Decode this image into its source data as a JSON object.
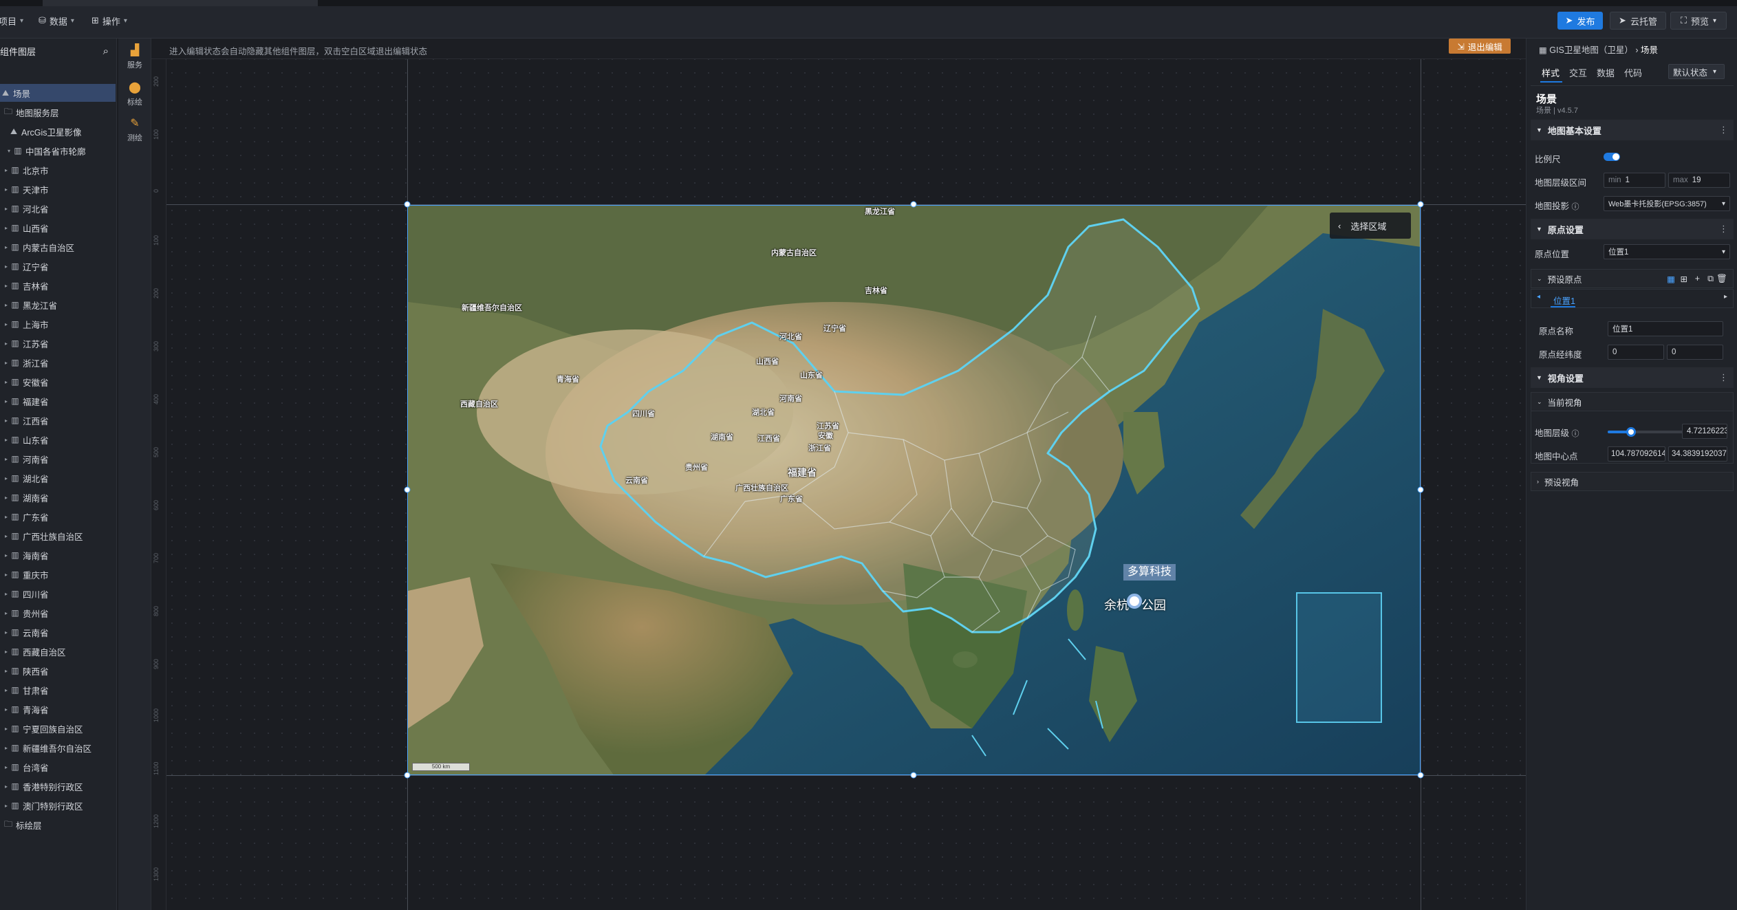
{
  "topbar": {
    "menus": [
      {
        "label": "项目",
        "icon": "folder-icon"
      },
      {
        "label": "数据",
        "icon": "database-icon"
      },
      {
        "label": "操作",
        "icon": "grid-icon"
      }
    ],
    "publish_label": "发布",
    "cloud_label": "云托管",
    "preview_label": "预览"
  },
  "layers": {
    "title": "组件图层",
    "items": [
      {
        "label": "场景",
        "icon": "scene-icon",
        "selected": true
      },
      {
        "label": "地图服务层",
        "icon": "folder-icon"
      },
      {
        "label": "ArcGis卫星影像",
        "icon": "scene-icon"
      },
      {
        "label": "中国各省市轮廓",
        "icon": "map-icon"
      },
      {
        "label": "北京市"
      },
      {
        "label": "天津市"
      },
      {
        "label": "河北省"
      },
      {
        "label": "山西省"
      },
      {
        "label": "内蒙古自治区"
      },
      {
        "label": "辽宁省"
      },
      {
        "label": "吉林省"
      },
      {
        "label": "黑龙江省"
      },
      {
        "label": "上海市"
      },
      {
        "label": "江苏省"
      },
      {
        "label": "浙江省"
      },
      {
        "label": "安徽省"
      },
      {
        "label": "福建省"
      },
      {
        "label": "江西省"
      },
      {
        "label": "山东省"
      },
      {
        "label": "河南省"
      },
      {
        "label": "湖北省"
      },
      {
        "label": "湖南省"
      },
      {
        "label": "广东省"
      },
      {
        "label": "广西壮族自治区"
      },
      {
        "label": "海南省"
      },
      {
        "label": "重庆市"
      },
      {
        "label": "四川省"
      },
      {
        "label": "贵州省"
      },
      {
        "label": "云南省"
      },
      {
        "label": "西藏自治区"
      },
      {
        "label": "陕西省"
      },
      {
        "label": "甘肃省"
      },
      {
        "label": "青海省"
      },
      {
        "label": "宁夏回族自治区"
      },
      {
        "label": "新疆维吾尔自治区"
      },
      {
        "label": "台湾省"
      },
      {
        "label": "香港特别行政区"
      },
      {
        "label": "澳门特别行政区"
      },
      {
        "label": "标绘层",
        "icon": "folder-icon"
      }
    ]
  },
  "tools": [
    {
      "label": "服务",
      "icon": "map-service-icon",
      "color": "#e8a23a"
    },
    {
      "label": "标绘",
      "icon": "pin-icon",
      "color": "#e8a23a"
    },
    {
      "label": "测绘",
      "icon": "measure-icon",
      "color": "#e8a23a"
    }
  ],
  "canvas": {
    "hint": "进入编辑状态会自动隐藏其他组件图层，双击空白区域退出编辑状态",
    "exit_label": "退出编辑",
    "ruler_ticks": [
      "200",
      "100",
      "0",
      "100",
      "200",
      "300",
      "400",
      "500",
      "600",
      "700",
      "800",
      "900",
      "1000",
      "1100",
      "1200",
      "1300"
    ]
  },
  "map": {
    "select_area_label": "选择区域",
    "scale_label": "500 km",
    "company_label": "多算科技",
    "poi_label": "余杭　公园",
    "provinces": [
      {
        "name": "黑龙江省"
      },
      {
        "name": "内蒙古自治区"
      },
      {
        "name": "吉林省"
      },
      {
        "name": "辽宁省"
      },
      {
        "name": "新疆维吾尔自治区"
      },
      {
        "name": "河北省"
      },
      {
        "name": "山西省"
      },
      {
        "name": "山东省"
      },
      {
        "name": "青海省"
      },
      {
        "name": "河南省"
      },
      {
        "name": "西藏自治区"
      },
      {
        "name": "江苏省"
      },
      {
        "name": "安徽"
      },
      {
        "name": "湖北省"
      },
      {
        "name": "四川省"
      },
      {
        "name": "浙江省"
      },
      {
        "name": "湖南省"
      },
      {
        "name": "贵州省"
      },
      {
        "name": "江西省"
      },
      {
        "name": "福建省"
      },
      {
        "name": "云南省"
      },
      {
        "name": "广西壮族自治区"
      },
      {
        "name": "广东省"
      }
    ]
  },
  "props": {
    "breadcrumb_root": "GIS卫星地图（卫星）",
    "breadcrumb_current": "场景",
    "tabs": [
      "样式",
      "交互",
      "数据",
      "代码"
    ],
    "state_select": "默认状态",
    "component_name": "场景",
    "component_version": "场景 | v4.5.7",
    "section_basic": "地图基本设置",
    "scale_label": "比例尺",
    "zoom_range_label": "地图层级区间",
    "zoom_min_prefix": "min",
    "zoom_min": "1",
    "zoom_max_prefix": "max",
    "zoom_max": "19",
    "projection_label": "地图投影",
    "projection_value": "Web墨卡托投影(EPSG:3857)",
    "section_origin": "原点设置",
    "origin_pos_label": "原点位置",
    "origin_pos_value": "位置1",
    "preset_origin": "预设原点",
    "origin_tab": "位置1",
    "origin_name_label": "原点名称",
    "origin_name_value": "位置1",
    "origin_lnglat_label": "原点经纬度",
    "origin_lng": "0",
    "origin_lat": "0",
    "section_view": "视角设置",
    "current_view": "当前视角",
    "map_zoom_label": "地图层级",
    "map_zoom_value": "4.72126223€",
    "map_zoom_level": 0.26,
    "map_center_label": "地图中心点",
    "map_center_lng": "104.7870926149",
    "map_center_lat": "34.3839192037(",
    "preset_view": "预设视角",
    "accent_color": "#1f7ae0"
  }
}
